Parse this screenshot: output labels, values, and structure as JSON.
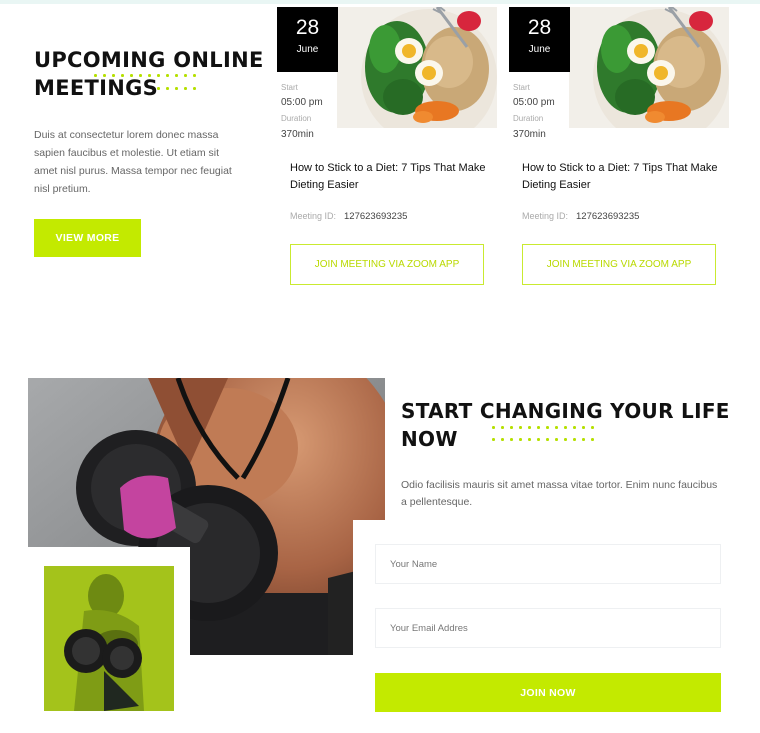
{
  "meetings": {
    "title": "UPCOMING ONLINE MEETINGS",
    "description": "Duis at consectetur lorem donec massa sapien faucibus et molestie. Ut etiam sit amet nisl purus. Massa tempor nec feugiat nisl pretium.",
    "view_more_label": "VIEW MORE",
    "cards": [
      {
        "day": "28",
        "month": "June",
        "start_label": "Start",
        "start_value": "05:00 pm",
        "duration_label": "Duration",
        "duration_value": "370min",
        "title": "How to Stick to a Diet: 7 Tips That Make Dieting Easier",
        "meeting_id_label": "Meeting ID:",
        "meeting_id_value": "127623693235",
        "join_label": "JOIN MEETING VIA ZOOM APP"
      },
      {
        "day": "28",
        "month": "June",
        "start_label": "Start",
        "start_value": "05:00 pm",
        "duration_label": "Duration",
        "duration_value": "370min",
        "title": "How to Stick to a Diet: 7 Tips That Make Dieting Easier",
        "meeting_id_label": "Meeting ID:",
        "meeting_id_value": "127623693235",
        "join_label": "JOIN MEETING VIA ZOOM APP"
      }
    ]
  },
  "signup": {
    "title": "START CHANGING YOUR LIFE NOW",
    "description": "Odio facilisis mauris sit amet massa vitae tortor. Enim nunc faucibus a pellentesque.",
    "name_placeholder": "Your Name",
    "email_placeholder": "Your Email Addres",
    "join_label": "JOIN NOW"
  },
  "colors": {
    "accent": "#c3ea00",
    "dark": "#111111",
    "date_box": "#000000"
  }
}
